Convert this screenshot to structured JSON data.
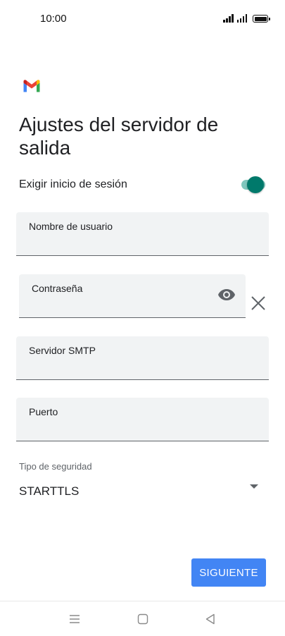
{
  "status_bar": {
    "time": "10:00"
  },
  "title": "Ajustes del servidor de salida",
  "require_login": {
    "label": "Exigir inicio de sesión",
    "enabled": true
  },
  "fields": {
    "username": {
      "label": "Nombre de usuario",
      "value": ""
    },
    "password": {
      "label": "Contraseña",
      "value": ""
    },
    "smtp_server": {
      "label": "Servidor SMTP",
      "value": ""
    },
    "port": {
      "label": "Puerto",
      "value": ""
    }
  },
  "security": {
    "label": "Tipo de seguridad",
    "selected": "STARTTLS"
  },
  "next_button": {
    "label": "SIGUIENTE"
  },
  "colors": {
    "accent": "#4285f4",
    "toggle_thumb": "#00796b",
    "toggle_track": "#7fc6bd",
    "field_background": "#f1f3f4"
  },
  "icons": [
    "gmail-logo",
    "eye-icon",
    "close-icon",
    "dropdown-arrow-icon",
    "menu-icon",
    "home-icon",
    "back-icon"
  ]
}
